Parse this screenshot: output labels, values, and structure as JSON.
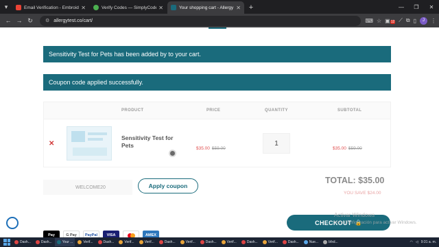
{
  "browser": {
    "tabs": [
      {
        "title": "Email Verification - Embroidery",
        "favicon_color": "#ea4335",
        "active": false
      },
      {
        "title": "Verify Codes — SimplyCodes",
        "favicon_color": "#4caf50",
        "active": false
      },
      {
        "title": "Your shopping cart - Allergy Te",
        "favicon_color": "#1a6b7c",
        "active": true
      }
    ],
    "url": "allergytest.co/cart/",
    "ext_badge": "12",
    "profile_initial": "J"
  },
  "notices": {
    "added": "Sensitivity Test for Pets has been added by to your cart.",
    "coupon": "Coupon code applied successfully."
  },
  "cart": {
    "headers": {
      "product": "PRODUCT",
      "price": "PRICE",
      "quantity": "QUANTITY",
      "subtotal": "SUBTOTAL"
    },
    "item": {
      "name": "Sensitivity Test for Pets",
      "price_sale": "$35.00",
      "price_regular": "$59.00",
      "quantity": "1",
      "subtotal_sale": "$35.00",
      "subtotal_regular": "$59.00"
    }
  },
  "coupon": {
    "code": "WELCOME20",
    "apply_label": "Apply coupon"
  },
  "summary": {
    "total": "TOTAL: $35.00",
    "you_save": "YOU SAVE $24.00"
  },
  "checkout_label": "CHECKOUT",
  "payments": [
    "Pay",
    "G Pay",
    "PayPal",
    "VISA",
    "MC",
    "AMEX"
  ],
  "watermark": {
    "line1": "Activar Windows",
    "line2": "Ve a Configuración para activar Windows."
  },
  "taskbar": {
    "items": [
      "Dash...",
      "Dash...",
      "Your ...",
      "Verif...",
      "Dash...",
      "Verif...",
      "Verif...",
      "Dash...",
      "Verif...",
      "Dash...",
      "Verif...",
      "Dash...",
      "Verif...",
      "Dash...",
      "Nue...",
      "bfxd..."
    ],
    "clock": "9:31 a. m."
  },
  "colors": {
    "brand": "#1a6b7c",
    "sale": "#e05050"
  }
}
